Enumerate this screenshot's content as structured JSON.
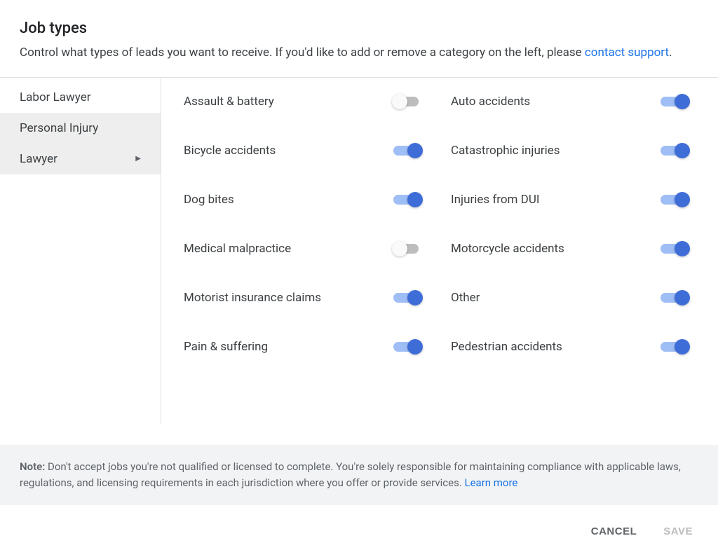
{
  "header": {
    "title": "Job types",
    "description_prefix": "Control what types of leads you want to receive. If you'd like to add or remove a category on the left, please ",
    "contact_link": "contact support",
    "description_suffix": "."
  },
  "sidebar": {
    "items": [
      {
        "label": "Labor Lawyer",
        "selected": false
      },
      {
        "label": "Personal Injury",
        "selected": true
      },
      {
        "label": "Lawyer",
        "selected": true,
        "arrow": "▶"
      }
    ]
  },
  "job_types": [
    {
      "label": "Assault & battery",
      "on": false
    },
    {
      "label": "Auto accidents",
      "on": true
    },
    {
      "label": "Bicycle accidents",
      "on": true
    },
    {
      "label": "Catastrophic injuries",
      "on": true
    },
    {
      "label": "Dog bites",
      "on": true
    },
    {
      "label": "Injuries from DUI",
      "on": true
    },
    {
      "label": "Medical malpractice",
      "on": false
    },
    {
      "label": "Motorcycle accidents",
      "on": true
    },
    {
      "label": "Motorist insurance claims",
      "on": true
    },
    {
      "label": "Other",
      "on": true
    },
    {
      "label": "Pain & suffering",
      "on": true
    },
    {
      "label": "Pedestrian accidents",
      "on": true
    }
  ],
  "note": {
    "prefix": "Note:",
    "text": " Don't accept jobs you're not qualified or licensed to complete. You're solely responsible for maintaining compliance with applicable laws, regulations, and licensing requirements in each jurisdiction where you offer or provide services. ",
    "learn_more": "Learn more"
  },
  "footer": {
    "cancel": "CANCEL",
    "save": "SAVE"
  }
}
